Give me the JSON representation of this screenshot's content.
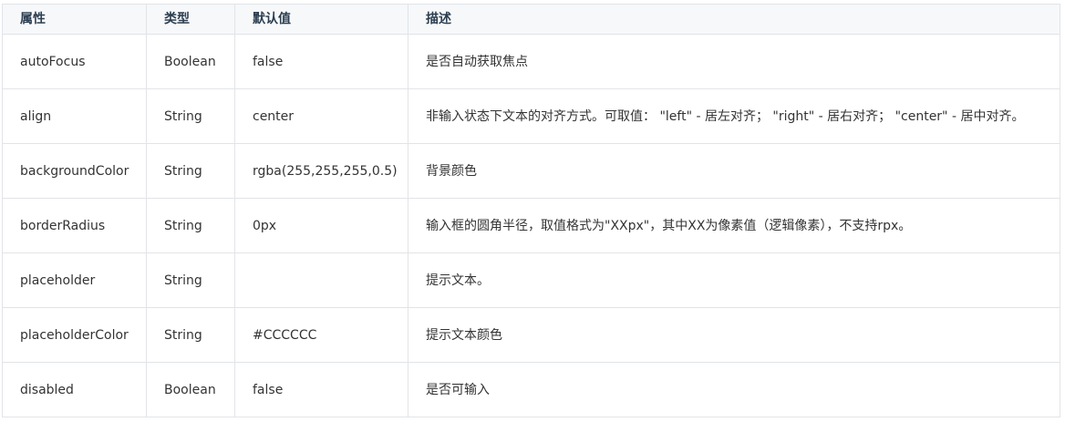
{
  "table": {
    "headers": [
      "属性",
      "类型",
      "默认值",
      "描述"
    ],
    "rows": [
      [
        "autoFocus",
        "Boolean",
        "false",
        "是否自动获取焦点"
      ],
      [
        "align",
        "String",
        "center",
        "非输入状态下文本的对齐方式。可取值： \"left\" - 居左对齐； \"right\" - 居右对齐； \"center\" - 居中对齐。"
      ],
      [
        "backgroundColor",
        "String",
        "rgba(255,255,255,0.5)",
        "背景颜色"
      ],
      [
        "borderRadius",
        "String",
        "0px",
        "输入框的圆角半径，取值格式为\"XXpx\"，其中XX为像素值（逻辑像素），不支持rpx。"
      ],
      [
        "placeholder",
        "String",
        "",
        "提示文本。"
      ],
      [
        "placeholderColor",
        "String",
        "#CCCCCC",
        "提示文本颜色"
      ],
      [
        "disabled",
        "Boolean",
        "false",
        "是否可输入"
      ]
    ]
  },
  "colors": {
    "border": "#e1e4e8",
    "header_bg": "#f6f8fa",
    "text": "#333333"
  }
}
